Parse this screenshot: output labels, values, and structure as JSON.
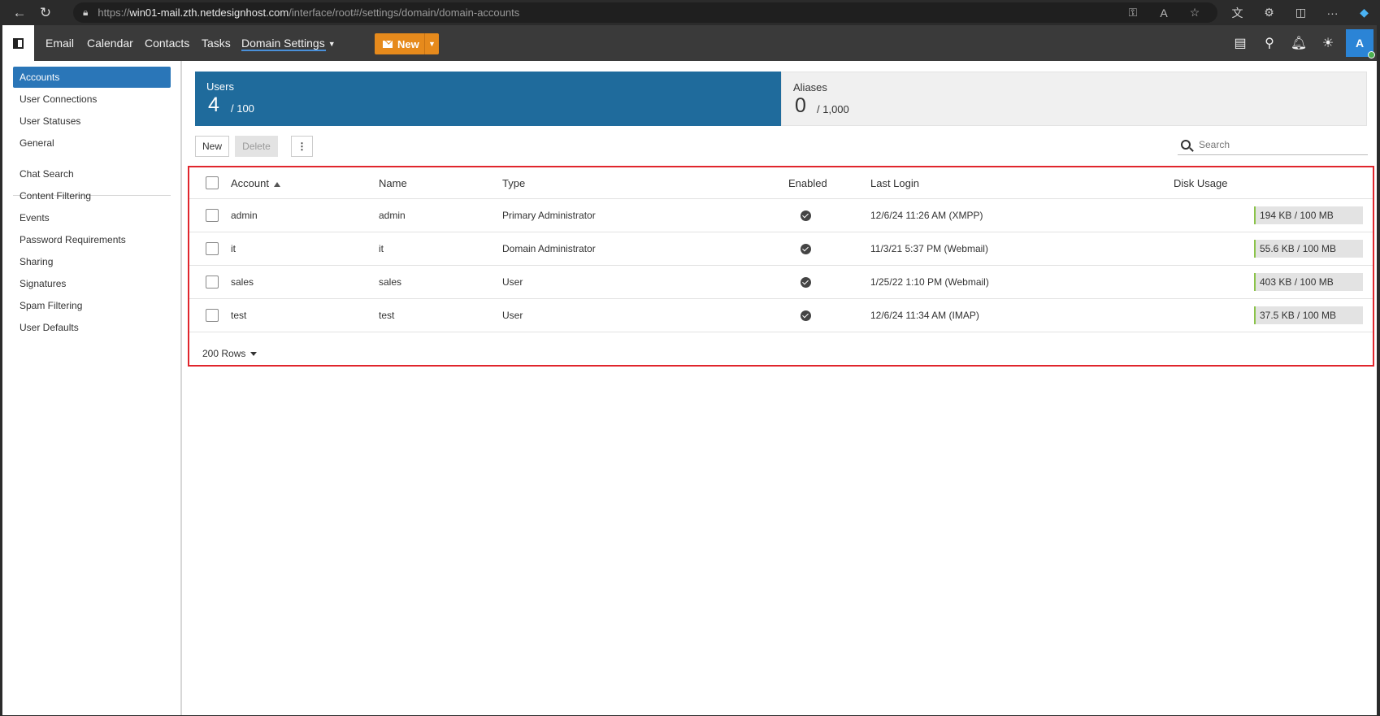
{
  "browser": {
    "url_prefix": "https://",
    "url_host": "win01-mail.zth.netdesignhost.com",
    "url_path": "/interface/root#/settings/domain/domain-accounts"
  },
  "topnav": {
    "links": [
      "Email",
      "Calendar",
      "Contacts",
      "Tasks",
      "Domain Settings"
    ],
    "new_label": "New",
    "avatar_initial": "A"
  },
  "sidebar": {
    "items": [
      "Accounts",
      "User Connections",
      "User Statuses",
      "General",
      "Chat Search",
      "Content Filtering",
      "Events",
      "Password Requirements",
      "Sharing",
      "Signatures",
      "Spam Filtering",
      "User Defaults"
    ]
  },
  "stats": {
    "users": {
      "label": "Users",
      "count": "4",
      "limit": "/ 100"
    },
    "aliases": {
      "label": "Aliases",
      "count": "0",
      "limit": "/ 1,000"
    }
  },
  "toolbar": {
    "new_label": "New",
    "delete_label": "Delete",
    "search_placeholder": "Search"
  },
  "table": {
    "headers": [
      "Account",
      "Name",
      "Type",
      "Enabled",
      "Last Login",
      "Disk Usage"
    ],
    "rows": [
      {
        "account": "admin",
        "name": "admin",
        "type": "Primary Administrator",
        "last_login": "12/6/24 11:26 AM (XMPP)",
        "disk": "194 KB / 100 MB"
      },
      {
        "account": "it",
        "name": "it",
        "type": "Domain Administrator",
        "last_login": "11/3/21 5:37 PM (Webmail)",
        "disk": "55.6 KB / 100 MB"
      },
      {
        "account": "sales",
        "name": "sales",
        "type": "User",
        "last_login": "1/25/22 1:10 PM (Webmail)",
        "disk": "403 KB / 100 MB"
      },
      {
        "account": "test",
        "name": "test",
        "type": "User",
        "last_login": "12/6/24 11:34 AM (IMAP)",
        "disk": "37.5 KB / 100 MB"
      }
    ],
    "rows_per_page": "200 Rows"
  }
}
